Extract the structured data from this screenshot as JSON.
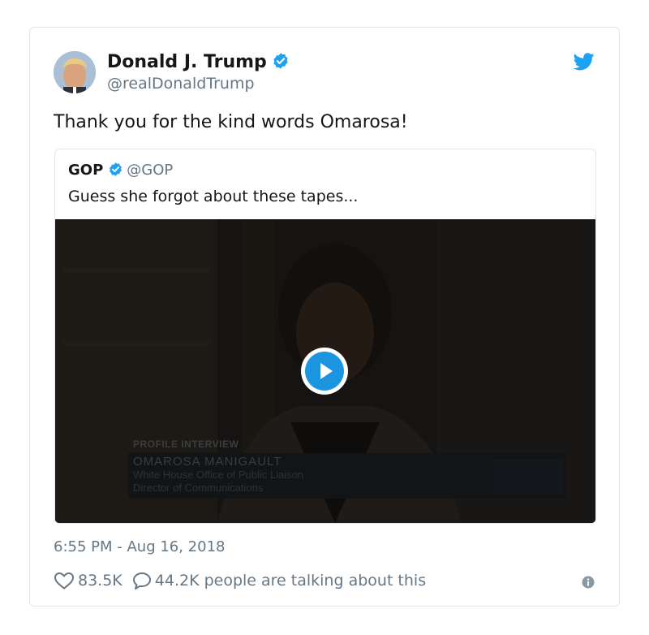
{
  "tweet": {
    "author_name": "Donald J. Trump",
    "author_handle": "@realDonaldTrump",
    "text": "Thank you for the kind words Omarosa!",
    "timestamp": "6:55 PM - Aug 16, 2018",
    "likes": "83.5K",
    "replies": "44.2K people are talking about this"
  },
  "quoted": {
    "author_name": "GOP",
    "author_handle": "@GOP",
    "text": "Guess she forgot about these tapes...",
    "video": {
      "tag": "PROFILE INTERVIEW",
      "name": "OMAROSA MANIGAULT",
      "line1": "White House Office of Public Liaison",
      "line2": "Director of Communications"
    }
  },
  "icons": {
    "verified": "verified-badge-icon",
    "brand": "twitter-bird-icon",
    "play": "play-icon",
    "like": "heart-icon",
    "reply": "speech-bubble-icon",
    "info": "info-icon"
  },
  "colors": {
    "accent": "#1da1f2",
    "play": "#1b95e0",
    "secondary_text": "#657786",
    "border": "#e1e8ed"
  }
}
